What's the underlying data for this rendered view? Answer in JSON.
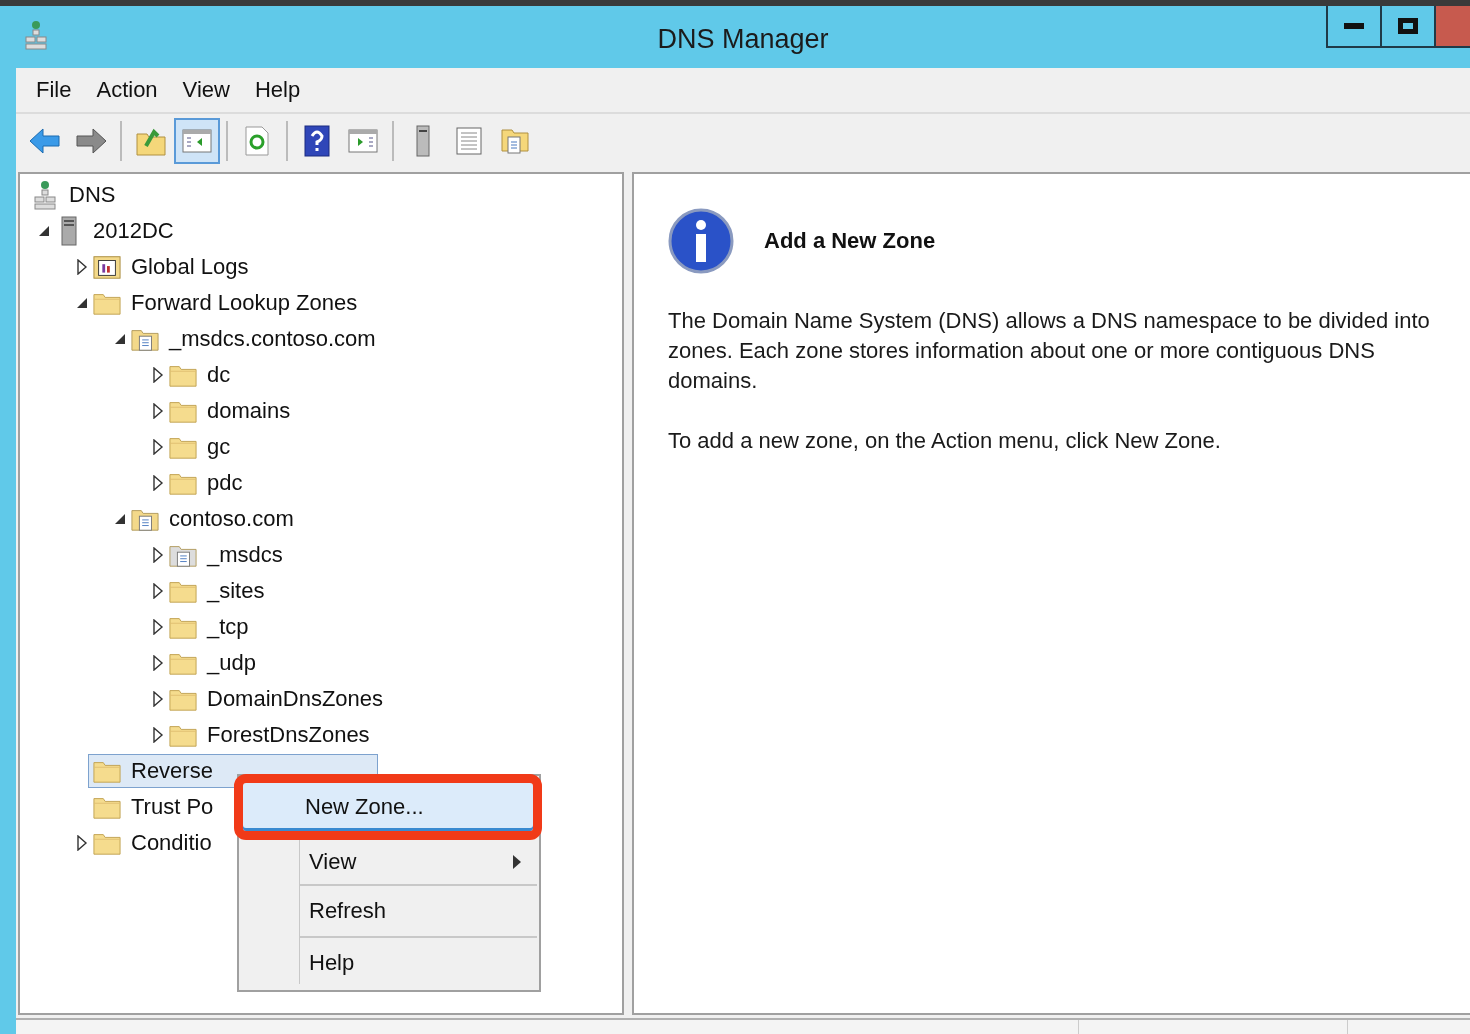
{
  "window": {
    "title": "DNS Manager"
  },
  "menu": [
    "File",
    "Action",
    "View",
    "Help"
  ],
  "toolbar": [
    {
      "buttons": [
        {
          "kind": "back",
          "pressed": false
        },
        {
          "kind": "forward",
          "pressed": false
        }
      ]
    },
    {
      "buttons": [
        {
          "kind": "up",
          "pressed": false
        },
        {
          "kind": "tree-toggle",
          "pressed": true
        }
      ]
    },
    {
      "buttons": [
        {
          "kind": "refresh",
          "pressed": false
        }
      ]
    },
    {
      "buttons": [
        {
          "kind": "help",
          "pressed": false
        },
        {
          "kind": "action-pane",
          "pressed": false
        }
      ]
    },
    {
      "buttons": [
        {
          "kind": "server",
          "pressed": false
        },
        {
          "kind": "list",
          "pressed": false
        },
        {
          "kind": "folders",
          "pressed": false
        }
      ]
    }
  ],
  "tree": [
    {
      "label": "DNS",
      "kind": "dns",
      "selected": false,
      "children": [
        {
          "label": "2012DC",
          "kind": "server",
          "expanded": true,
          "selected": false,
          "children": [
            {
              "label": "Global Logs",
              "kind": "log",
              "expanded": false,
              "selected": false
            },
            {
              "label": "Forward Lookup Zones",
              "kind": "folder",
              "expanded": true,
              "selected": false,
              "children": [
                {
                  "label": "_msdcs.contoso.com",
                  "kind": "zone",
                  "expanded": true,
                  "selected": false,
                  "children": [
                    {
                      "label": "dc",
                      "kind": "folder",
                      "expanded": false,
                      "selected": false
                    },
                    {
                      "label": "domains",
                      "kind": "folder",
                      "expanded": false,
                      "selected": false
                    },
                    {
                      "label": "gc",
                      "kind": "folder",
                      "expanded": false,
                      "selected": false
                    },
                    {
                      "label": "pdc",
                      "kind": "folder",
                      "expanded": false,
                      "selected": false
                    }
                  ]
                },
                {
                  "label": "contoso.com",
                  "kind": "zone",
                  "expanded": true,
                  "selected": false,
                  "children": [
                    {
                      "label": "_msdcs",
                      "kind": "delegation",
                      "expanded": false,
                      "selected": false
                    },
                    {
                      "label": "_sites",
                      "kind": "folder",
                      "expanded": false,
                      "selected": false
                    },
                    {
                      "label": "_tcp",
                      "kind": "folder",
                      "expanded": false,
                      "selected": false
                    },
                    {
                      "label": "_udp",
                      "kind": "folder",
                      "expanded": false,
                      "selected": false
                    },
                    {
                      "label": "DomainDnsZones",
                      "kind": "folder",
                      "expanded": false,
                      "selected": false
                    },
                    {
                      "label": "ForestDnsZones",
                      "kind": "folder",
                      "expanded": false,
                      "selected": false
                    }
                  ]
                }
              ]
            },
            {
              "label": "Reverse",
              "kind": "folder",
              "selected": true
            },
            {
              "label": "Trust Po",
              "kind": "folder",
              "selected": false
            },
            {
              "label": "Conditio",
              "kind": "folder",
              "expanded": false,
              "selected": false
            }
          ]
        }
      ]
    }
  ],
  "detail": {
    "title": "Add a New Zone",
    "paragraphs": [
      "The Domain Name System (DNS) allows a DNS namespace to be divided into zones. Each zone stores information about one or more contiguous DNS domains.",
      "To add a new zone, on the Action menu, click New Zone."
    ]
  },
  "context_menu": [
    {
      "label": "New Zone...",
      "selected": true,
      "submenu": false,
      "emphasized": true
    },
    {
      "label": "View",
      "selected": false,
      "submenu": true,
      "emphasized": false
    },
    {
      "label": "Refresh",
      "selected": false,
      "submenu": false,
      "emphasized": false
    },
    {
      "label": "Help",
      "selected": false,
      "submenu": false,
      "emphasized": false
    }
  ]
}
